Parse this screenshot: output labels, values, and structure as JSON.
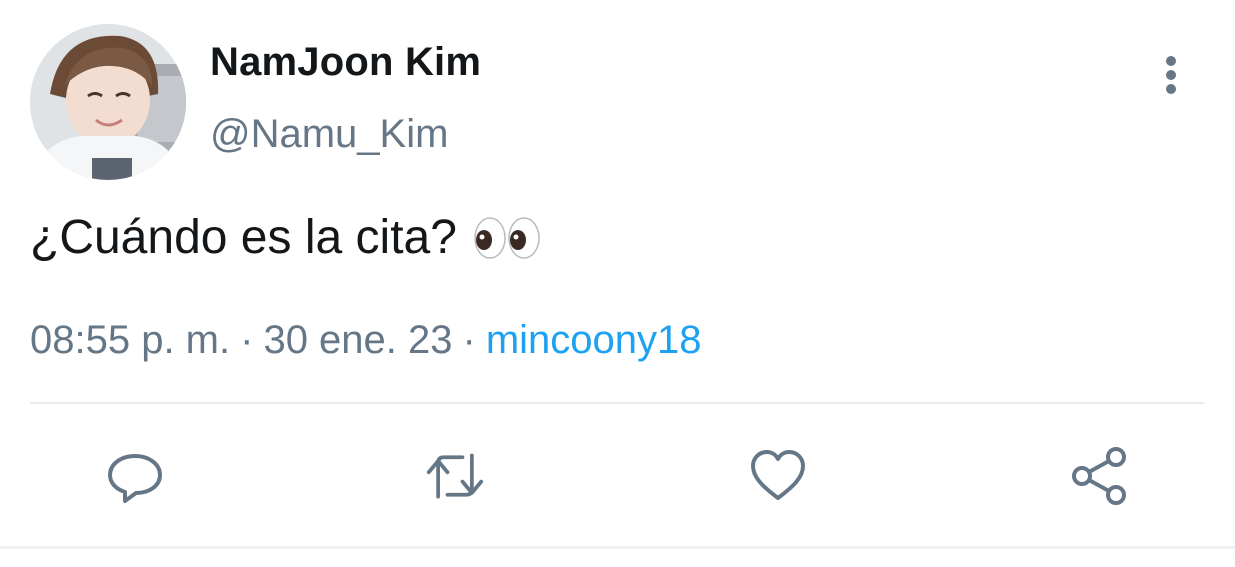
{
  "author": {
    "display_name": "NamJoon Kim",
    "handle": "@Namu_Kim",
    "avatar_icon": "profile-photo"
  },
  "tweet": {
    "text": "¿Cuándo es la cita?",
    "emoji": "eyes-emoji"
  },
  "meta": {
    "time": "08:55 p. m.",
    "separator": "·",
    "date": "30 ene. 23",
    "source": "mincoony18"
  },
  "actions": [
    {
      "name": "reply",
      "icon": "reply-icon"
    },
    {
      "name": "retweet",
      "icon": "retweet-icon"
    },
    {
      "name": "like",
      "icon": "heart-icon"
    },
    {
      "name": "share",
      "icon": "share-icon"
    }
  ],
  "colors": {
    "text": "#14171a",
    "secondary": "#657786",
    "accent": "#1da1f2",
    "divider": "#e6ecf0"
  }
}
